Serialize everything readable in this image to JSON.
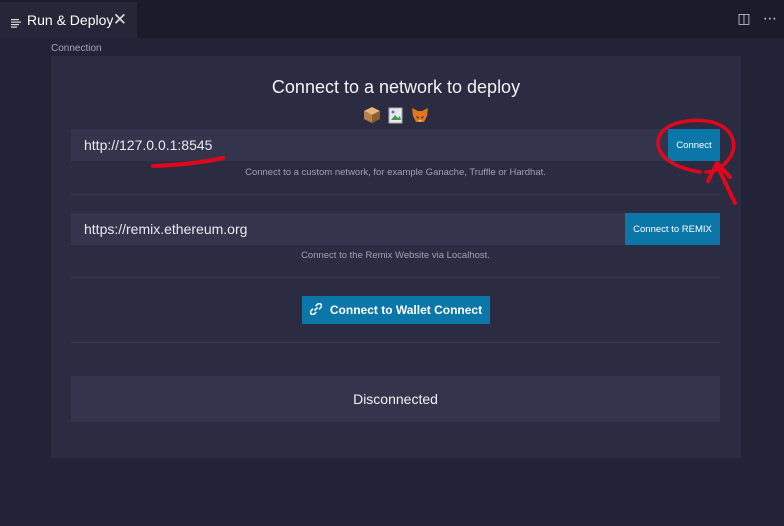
{
  "tab": {
    "title": "Run & Deploy",
    "close_glyph": "✕",
    "icon": "list-icon",
    "actions": [
      {
        "name": "split-editor-icon",
        "glyph": "◫"
      },
      {
        "name": "more-actions-icon",
        "glyph": "⋯"
      }
    ]
  },
  "section": {
    "label": "Connection"
  },
  "connect_panel": {
    "title": "Connect to a network to deploy",
    "wallet_icons": [
      "ganache-icon",
      "broken-image-icon",
      "metamask-fox-icon"
    ],
    "custom_network": {
      "url": "http://127.0.0.1:8545",
      "button": "Connect",
      "hint": "Connect to a custom network, for example Ganache, Truffle or Hardhat."
    },
    "remix": {
      "url": "https://remix.ethereum.org",
      "button": "Connect to REMIX",
      "hint": "Connect to the Remix Website via Localhost."
    },
    "wallet_connect": {
      "label": "Connect to Wallet Connect",
      "icon": "link-icon"
    },
    "status": "Disconnected"
  },
  "colors": {
    "background": "#222336",
    "panel": "#2b2c41",
    "input": "#34354c",
    "accent": "#0b76a8",
    "annotation": "#e0061b"
  }
}
